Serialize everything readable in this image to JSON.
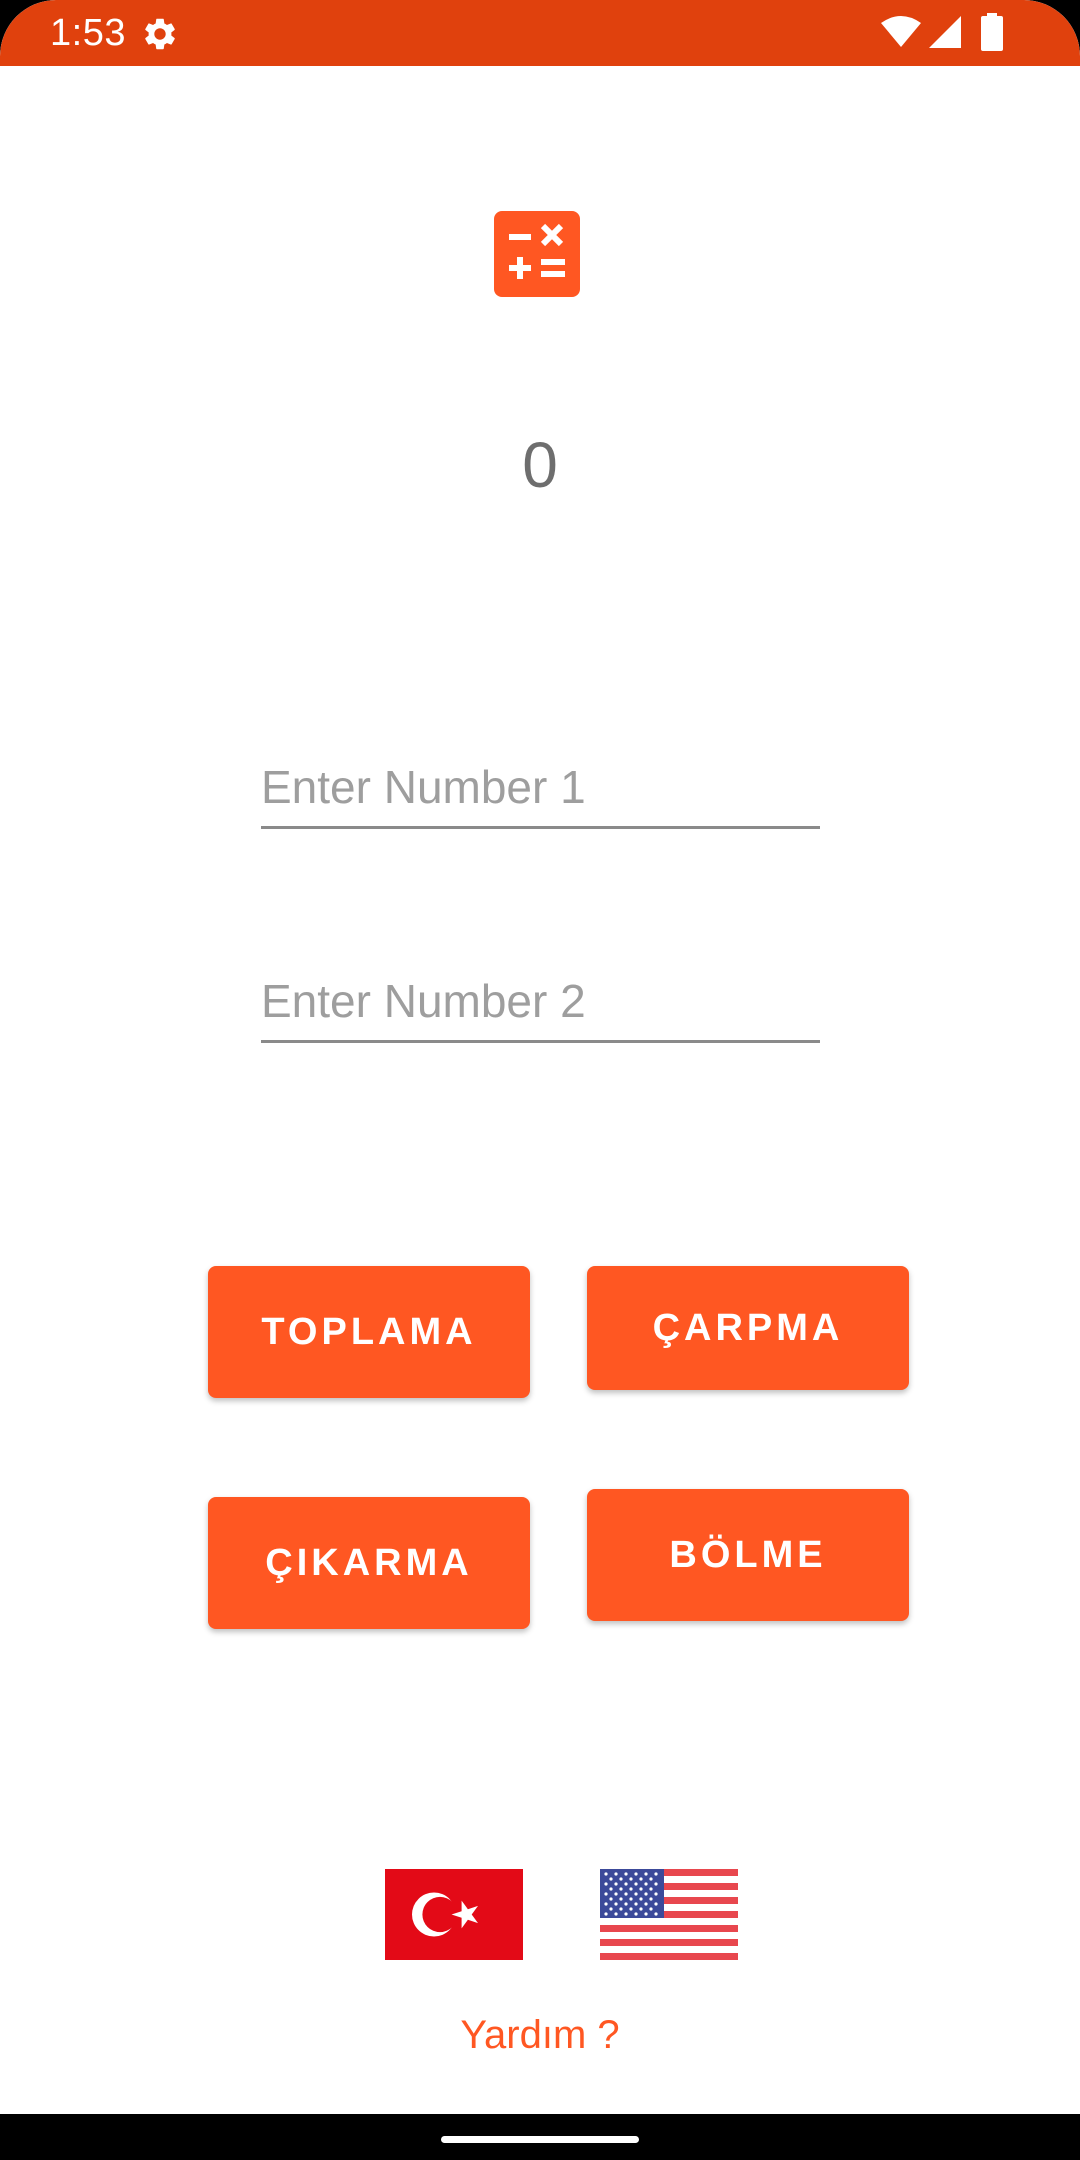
{
  "status_bar": {
    "time": "1:53",
    "icons": [
      "gear-icon",
      "wifi-icon",
      "cellular-signal-icon",
      "battery-icon"
    ],
    "color": "#E0410D"
  },
  "app": {
    "icon": "calculator-icon",
    "accent_color": "#FF5722"
  },
  "result": {
    "value": "0"
  },
  "inputs": {
    "number1": {
      "value": "",
      "placeholder": "Enter Number 1"
    },
    "number2": {
      "value": "",
      "placeholder": "Enter Number 2"
    }
  },
  "operations": {
    "add": "TOPLAMA",
    "multiply": "ÇARPMA",
    "subtract": "ÇIKARMA",
    "divide": "BÖLME"
  },
  "languages": {
    "turkish_flag": "turkey-flag-icon",
    "english_flag": "usa-flag-icon"
  },
  "help": {
    "label": "Yardım ?"
  }
}
